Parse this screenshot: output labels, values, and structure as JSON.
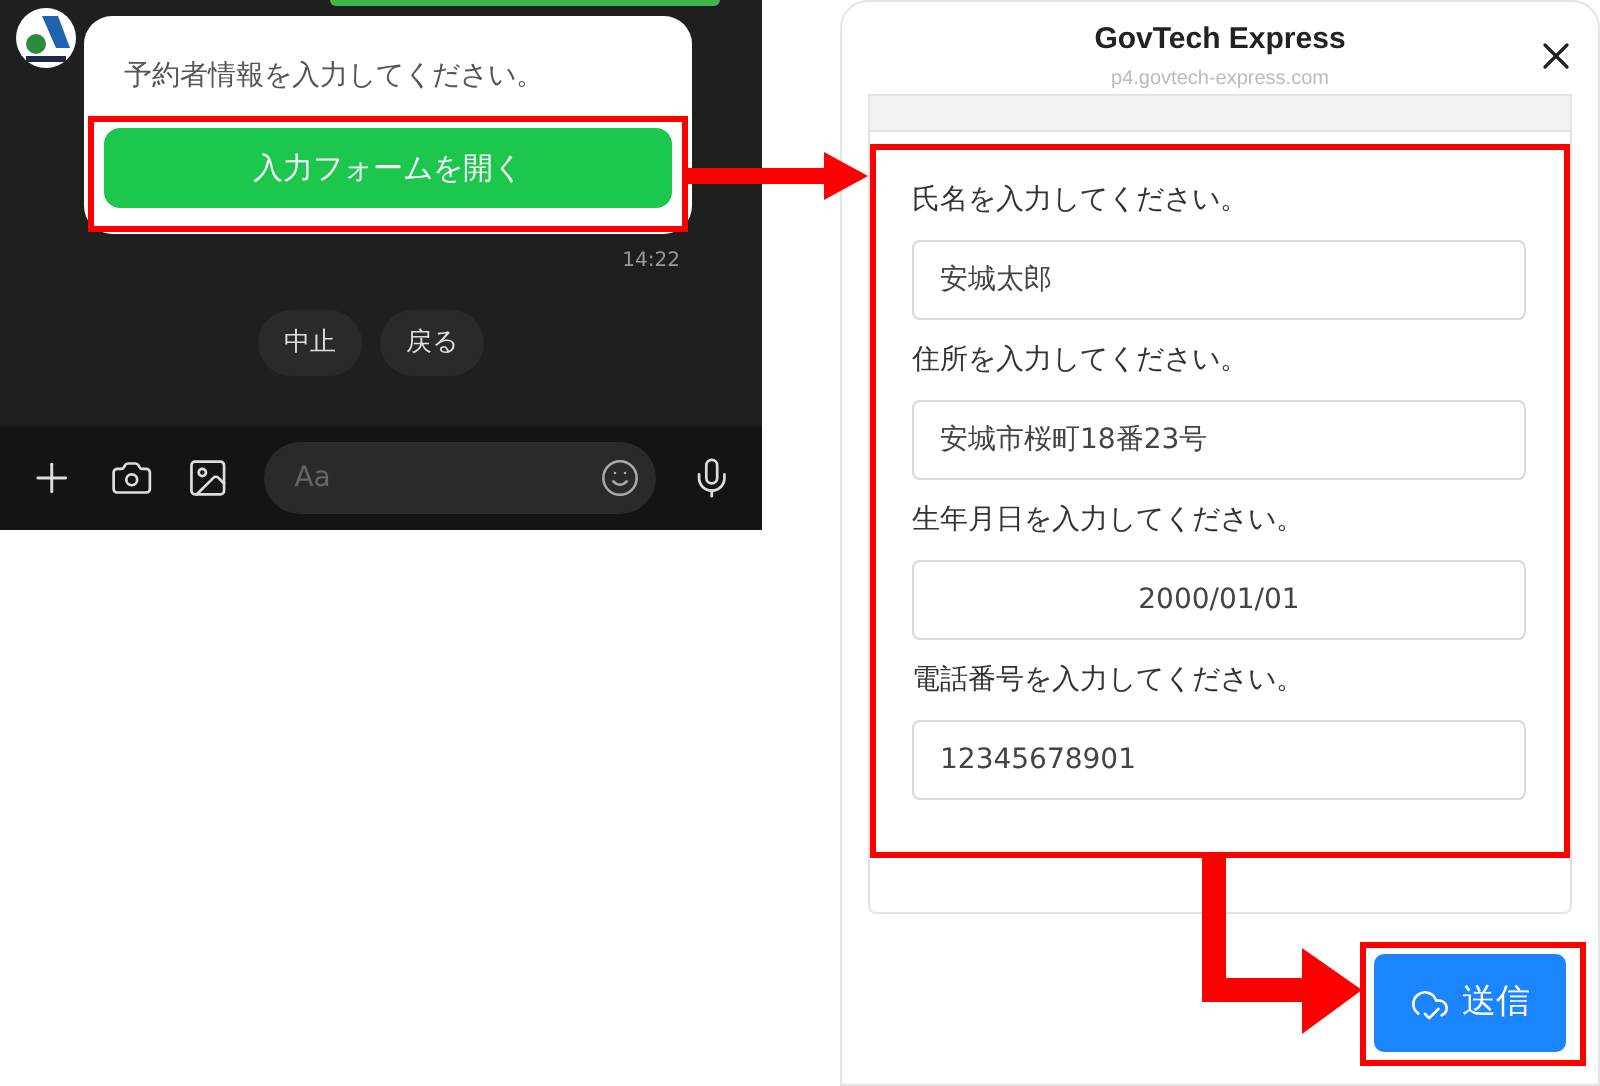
{
  "chat": {
    "message": "予約者情報を入力してください。",
    "action_button": "入力フォームを開く",
    "time": "14:22",
    "quick_replies": [
      "中止",
      "戻る"
    ],
    "composer": {
      "placeholder": "Aa"
    }
  },
  "form_window": {
    "title": "GovTech Express",
    "url": "p4.govtech-express.com",
    "fields": [
      {
        "label": "氏名を入力してください。",
        "value": "安城太郎",
        "kind": "text"
      },
      {
        "label": "住所を入力してください。",
        "value": "安城市桜町18番23号",
        "kind": "text"
      },
      {
        "label": "生年月日を入力してください。",
        "value": "2000/01/01",
        "kind": "date"
      },
      {
        "label": "電話番号を入力してください。",
        "value": "12345678901",
        "kind": "text"
      }
    ],
    "submit_button": "送信"
  }
}
